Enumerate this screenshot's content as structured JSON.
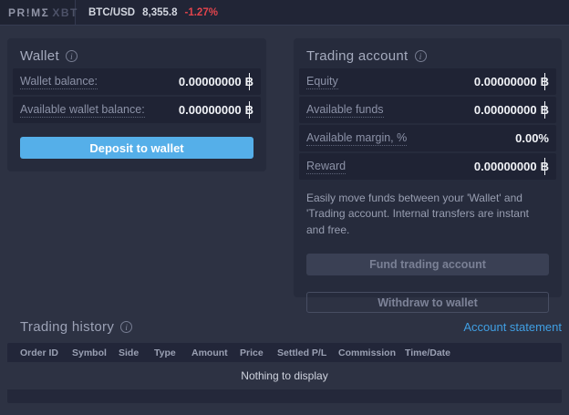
{
  "topbar": {
    "logo": {
      "text": "PR!MΣ",
      "suffix": "XBT"
    },
    "ticker": {
      "pair": "BTC/USD",
      "price": "8,355.8",
      "change": "-1.27%"
    }
  },
  "wallet": {
    "title": "Wallet",
    "rows": [
      {
        "label": "Wallet balance:",
        "value": "0.00000000",
        "currency_symbol": "฿"
      },
      {
        "label": "Available wallet balance:",
        "value": "0.00000000",
        "currency_symbol": "฿"
      }
    ],
    "deposit_button": "Deposit to wallet"
  },
  "trading_account": {
    "title": "Trading account",
    "rows": [
      {
        "label": "Equity",
        "value": "0.00000000",
        "currency_symbol": "฿"
      },
      {
        "label": "Available funds",
        "value": "0.00000000",
        "currency_symbol": "฿"
      },
      {
        "label": "Available margin, %",
        "value": "0.00%",
        "currency_symbol": ""
      },
      {
        "label": "Reward",
        "value": "0.00000000",
        "currency_symbol": "฿"
      }
    ],
    "info_text": "Easily move funds between your 'Wallet' and 'Trading account. Internal transfers are instant and free.",
    "fund_button": "Fund trading account",
    "withdraw_button": "Withdraw to wallet"
  },
  "history": {
    "title": "Trading history",
    "statement_link": "Account statement",
    "columns": [
      "Order ID",
      "Symbol",
      "Side",
      "Type",
      "Amount",
      "Price",
      "Settled P/L",
      "Commission",
      "Time/Date"
    ],
    "empty_message": "Nothing to display"
  },
  "colors": {
    "page_bg": "#2d3243",
    "topbar_bg": "#212536",
    "card_bg": "#262b3c",
    "row_bg": "#1f2334",
    "accent_blue": "#55afe9",
    "link_blue": "#409fe3",
    "negative_red": "#e2444c"
  }
}
